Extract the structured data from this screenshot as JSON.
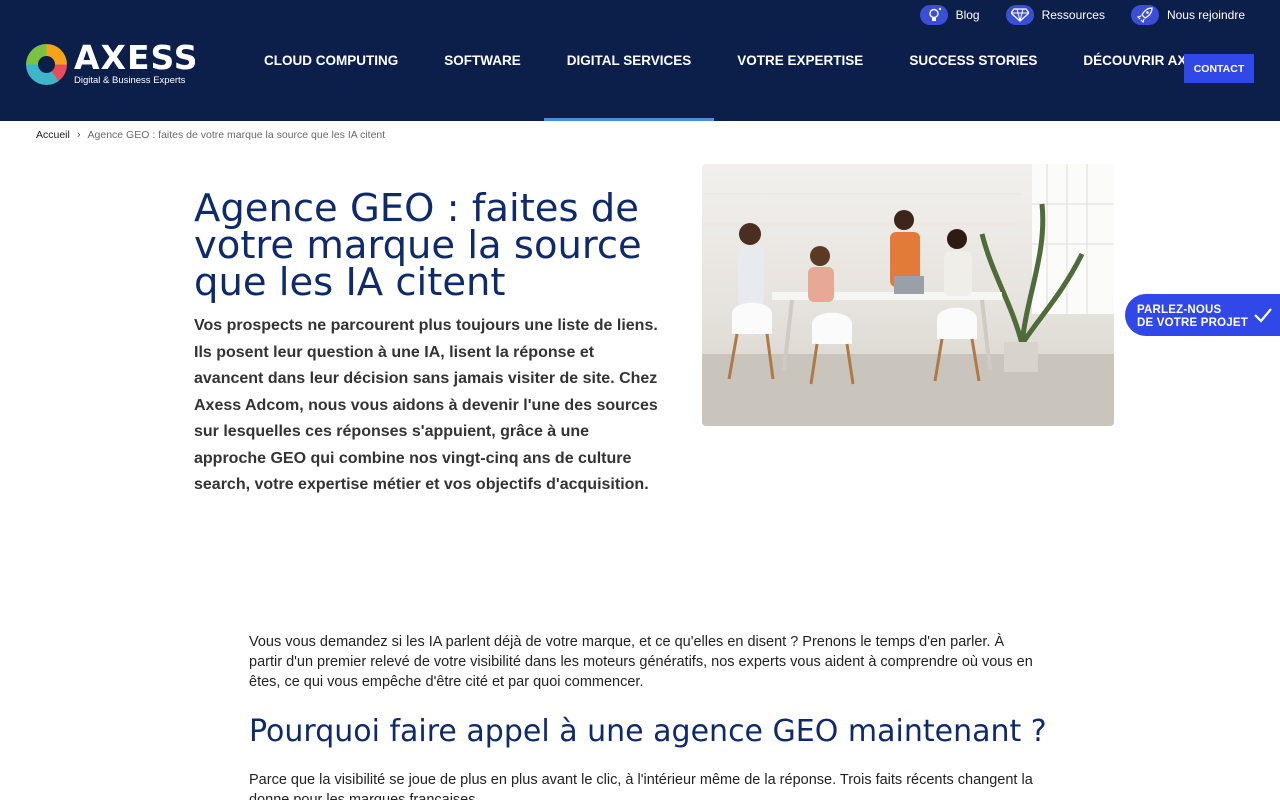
{
  "brand": {
    "name": "AXESS",
    "tagline": "Digital & Business Experts"
  },
  "toplinks": [
    {
      "label": "Blog",
      "icon": "lightbulb-icon"
    },
    {
      "label": "Ressources",
      "icon": "diamond-icon"
    },
    {
      "label": "Nous rejoindre",
      "icon": "rocket-icon"
    }
  ],
  "nav": {
    "items": [
      "CLOUD COMPUTING",
      "SOFTWARE",
      "DIGITAL SERVICES",
      "VOTRE EXPERTISE",
      "SUCCESS STORIES",
      "DÉCOUVRIR AXESS"
    ],
    "active": "DIGITAL SERVICES",
    "contact_label": "CONTACT"
  },
  "breadcrumb": {
    "home": "Accueil",
    "current": "Agence GEO : faites de votre marque la source que les IA citent"
  },
  "hero": {
    "title": "Agence GEO : faites de votre marque la source que les IA citent",
    "lead": "Vos prospects ne parcourent plus toujours une liste de liens. Ils posent leur question à une IA, lisent la réponse et avancent dans leur décision sans jamais visiter de site. Chez Axess Adcom, nous vous aidons à devenir l'une des sources sur lesquelles ces réponses s'appuient, grâce à une approche GEO qui combine nos vingt-cinq ans de culture search, votre expertise métier et vos objectifs d'acquisition."
  },
  "cta_float": {
    "line1": "PARLEZ-NOUS",
    "line2": "DE VOTRE PROJET"
  },
  "content": {
    "intro": "Vous vous demandez si les IA parlent déjà de votre marque, et ce qu'elles en disent ? Prenons le temps d'en parler. À partir d'un premier relevé de votre visibilité dans les moteurs génératifs, nos experts vous aident à comprendre où vous en êtes, ce qui vous empêche d'être cité et par quoi commencer.",
    "h2": "Pourquoi faire appel à une agence GEO maintenant ?",
    "para2": "Parce que la visibilité se joue de plus en plus avant le clic, à l'intérieur même de la réponse. Trois faits récents changent la donne pour les marques françaises."
  },
  "colors": {
    "header_bg": "#0c1f4b",
    "accent": "#3048e8",
    "title": "#0f2a6b",
    "active_underline": "#4d8bdc"
  }
}
